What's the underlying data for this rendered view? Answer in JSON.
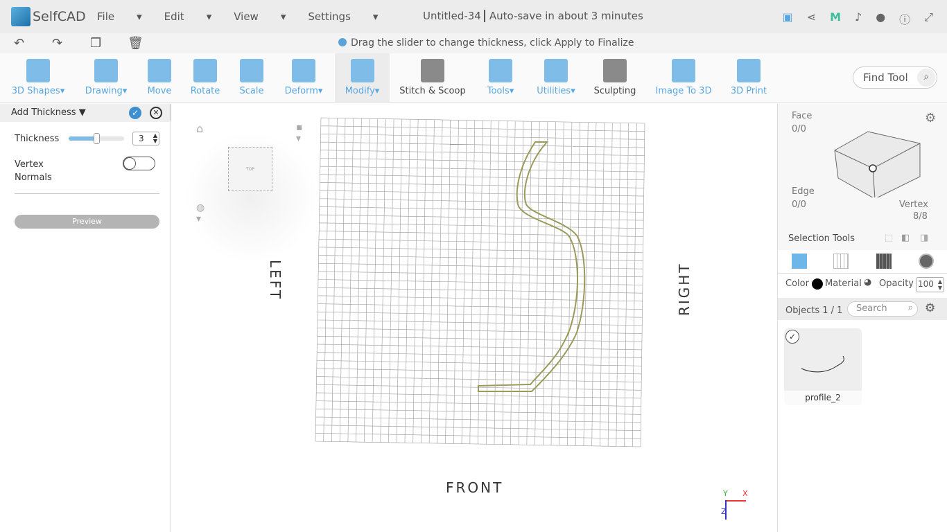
{
  "app": {
    "name": "SelfCAD",
    "menus": [
      "File",
      "Edit",
      "View",
      "Settings"
    ],
    "doc_title": "Untitled-34",
    "autosave": "Auto-save in about 3 minutes"
  },
  "hint": "Drag the slider to change thickness, click Apply to Finalize",
  "toolbar": [
    {
      "label": "3D Shapes",
      "dropdown": true
    },
    {
      "label": "Drawing",
      "dropdown": true
    },
    {
      "label": "Move"
    },
    {
      "label": "Rotate"
    },
    {
      "label": "Scale"
    },
    {
      "label": "Deform",
      "dropdown": true
    },
    {
      "label": "Modify",
      "dropdown": true,
      "selected": true
    },
    {
      "label": "Stitch & Scoop"
    },
    {
      "label": "Tools",
      "dropdown": true
    },
    {
      "label": "Utilities",
      "dropdown": true
    },
    {
      "label": "Sculpting"
    },
    {
      "label": "Image To 3D"
    },
    {
      "label": "3D Print"
    }
  ],
  "find_tool": "Find Tool",
  "panel": {
    "title": "Add Thickness",
    "thickness_label": "Thickness",
    "thickness": "3",
    "slider_fraction": 0.5,
    "vertex_normals": "Vertex Normals",
    "vertex_normals_on": false,
    "preview": "Preview"
  },
  "viewport": {
    "left": "LEFT",
    "right": "RIGHT",
    "front": "FRONT",
    "cube_face": "TOP",
    "axes": [
      "X",
      "Y",
      "Z"
    ],
    "curve_color": "#9a9a5a"
  },
  "right": {
    "face": "Face",
    "face_count": "0/0",
    "edge": "Edge",
    "edge_count": "0/0",
    "vertex": "Vertex",
    "vertex_count": "8/8",
    "selection_tools": "Selection Tools",
    "color_label": "Color",
    "color": "#000000",
    "material_label": "Material",
    "opacity_label": "Opacity",
    "opacity": "100",
    "objects": "Objects 1 / 1",
    "search_placeholder": "Search",
    "object_name": "profile_2"
  }
}
